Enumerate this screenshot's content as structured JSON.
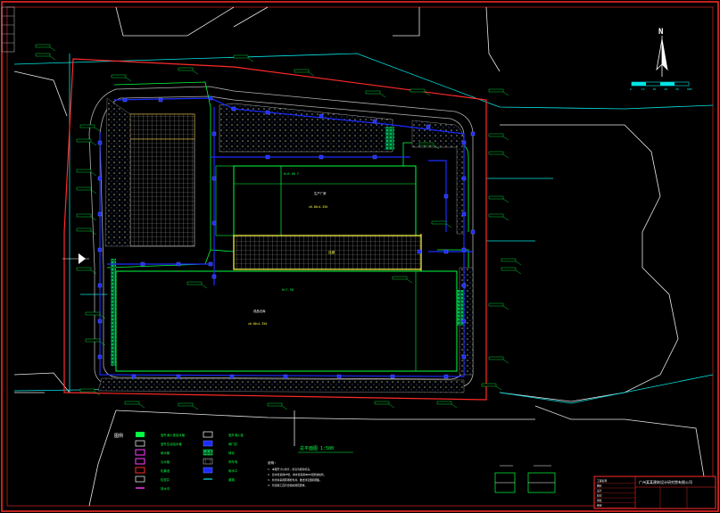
{
  "drawing": {
    "north_label": "N",
    "plan_title": "总平面图  1:500",
    "scale_bar_labels": [
      "0",
      "10",
      "20",
      "40",
      "60",
      "80M"
    ]
  },
  "buildings": {
    "north_hall_label": "H=6.00  F",
    "north_hall_name": "生产厂房",
    "north_hall_elev": "±0.00=4.350",
    "corridor_label": "连廊",
    "south_hall_label": "H=7.50",
    "south_hall_name": "成品仓库",
    "south_hall_elev": "±0.00=4.350"
  },
  "legend": {
    "title": "图例",
    "items_left": [
      {
        "swatch": "green-fill",
        "label": "室外消火栓给水管"
      },
      {
        "swatch": "white-box",
        "label": "室外生活给水管"
      },
      {
        "swatch": "magenta-box",
        "label": "雨水管"
      },
      {
        "swatch": "magenta-box2",
        "label": "污水管"
      },
      {
        "swatch": "red-box",
        "label": "化粪池"
      },
      {
        "swatch": "white-box2",
        "label": "检查井"
      },
      {
        "swatch": "magenta-line",
        "label": "排水沟"
      }
    ],
    "items_right": [
      {
        "swatch": "white-box",
        "label": "室外消火栓"
      },
      {
        "swatch": "blue-box",
        "label": "阀门井"
      },
      {
        "swatch": "green-hatch",
        "label": "绿化"
      },
      {
        "swatch": "grey-hatch",
        "label": "停车场"
      },
      {
        "swatch": "blue-box2",
        "label": "雨水口"
      },
      {
        "swatch": "cyan-line",
        "label": "道路"
      }
    ]
  },
  "notes": {
    "title": "说明:",
    "lines": [
      "1. 本图尺寸以米计，标高为绝对标高。",
      "2. 给水管采用PE管，排水管采用HDPE双壁波纹管。",
      "3. 检查井采用砖砌检查井，做法详见国标图集。",
      "4. 管道施工应符合相关规范要求。"
    ]
  },
  "title_block": {
    "company": "广州某某建筑设计研究院有限公司",
    "rows": [
      "工程名称",
      "图名",
      "设计",
      "校对",
      "审核",
      "审定"
    ]
  },
  "colors": {
    "site_boundary": "#ff2a2a",
    "building": "#00ff40",
    "road": "#a0a0a0",
    "pipe_blue": "#1c2cff",
    "pipe_cyan": "#00e5e5",
    "corridor": "#ffff40",
    "magenta": "#ff40ff",
    "white": "#ffffff"
  }
}
